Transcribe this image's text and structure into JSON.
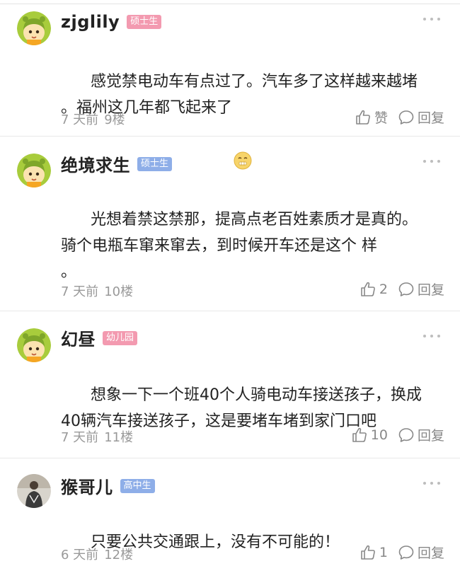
{
  "comments": [
    {
      "username": "zjglily",
      "badge": "硕士生",
      "badge_color": "#f39ab0",
      "avatar": "cartoon-avatar",
      "content": "感觉禁电动车有点过了。汽车多了这样越来越堵\n。福州这几年都飞起来了",
      "emoji": "sealed-mouth-emoji",
      "time": "7 天前",
      "floor": "9楼",
      "like_label": "赞",
      "reply_label": "回复"
    },
    {
      "username": "绝境求生",
      "badge": "硕士生",
      "badge_color": "#8eaee8",
      "avatar": "cartoon-avatar",
      "content": "光想着禁这禁那，提高点老百姓素质才是真的。\n骑个电瓶车窜来窜去，到时候开车还是这个 样\n。",
      "time": "7 天前",
      "floor": "10楼",
      "like_label": "2",
      "reply_label": "回复"
    },
    {
      "username": "幻昼",
      "badge": "幼儿园",
      "badge_color": "#f39ab0",
      "avatar": "cartoon-avatar",
      "content": "想象一下一个班40个人骑电动车接送孩子，换成\n40辆汽车接送孩子，这是要堵车堵到家门口吧",
      "time": "7 天前",
      "floor": "11楼",
      "like_label": "10",
      "reply_label": "回复"
    },
    {
      "username": "猴哥儿",
      "badge": "高中生",
      "badge_color": "#8eaee8",
      "avatar": "photo-avatar",
      "content": "只要公共交通跟上，没有不可能的！",
      "time": "6 天前",
      "floor": "12楼",
      "like_label": "1",
      "reply_label": "回复"
    }
  ],
  "icons": {
    "like": "thumbs-up-icon",
    "reply": "speech-bubble-icon",
    "more": "more-dots-icon"
  }
}
